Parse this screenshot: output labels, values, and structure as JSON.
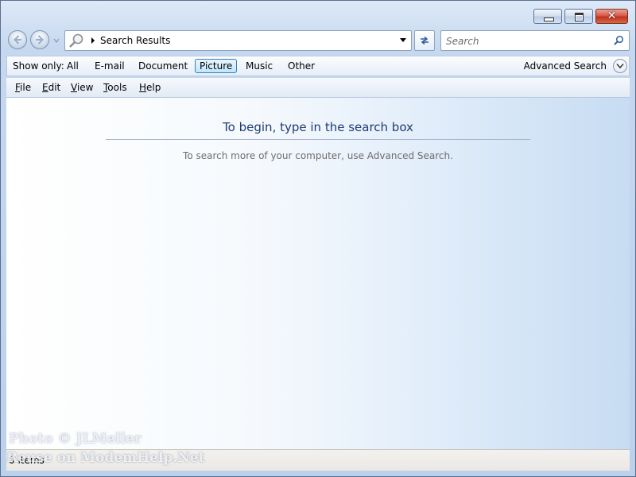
{
  "window": {
    "caption_buttons": [
      "minimize-icon",
      "maximize-icon",
      "close-icon"
    ],
    "close_glyph": "✕"
  },
  "nav": {
    "address_text": "Search Results",
    "search_placeholder": "Search"
  },
  "filter_bar": {
    "label": "Show only:",
    "items": [
      "All",
      "E-mail",
      "Document",
      "Picture",
      "Music",
      "Other"
    ],
    "active": "Picture",
    "advanced_label": "Advanced Search"
  },
  "menu": {
    "items": [
      {
        "accel": "F",
        "rest": "ile"
      },
      {
        "accel": "E",
        "rest": "dit"
      },
      {
        "accel": "V",
        "rest": "iew"
      },
      {
        "accel": "T",
        "rest": "ools"
      },
      {
        "accel": "H",
        "rest": "elp"
      }
    ]
  },
  "content": {
    "heading": "To begin, type in the search box",
    "subtext": "To search more of your computer, use Advanced Search."
  },
  "status": {
    "count": "0 items"
  },
  "watermark": {
    "line1": "Photo © JLMeller",
    "line2": "Reuse on ModemHelp.Net"
  },
  "colors": {
    "heading": "#1f3c72",
    "active_filter_border": "#3c7fb1",
    "close_button": "#c1321f"
  }
}
